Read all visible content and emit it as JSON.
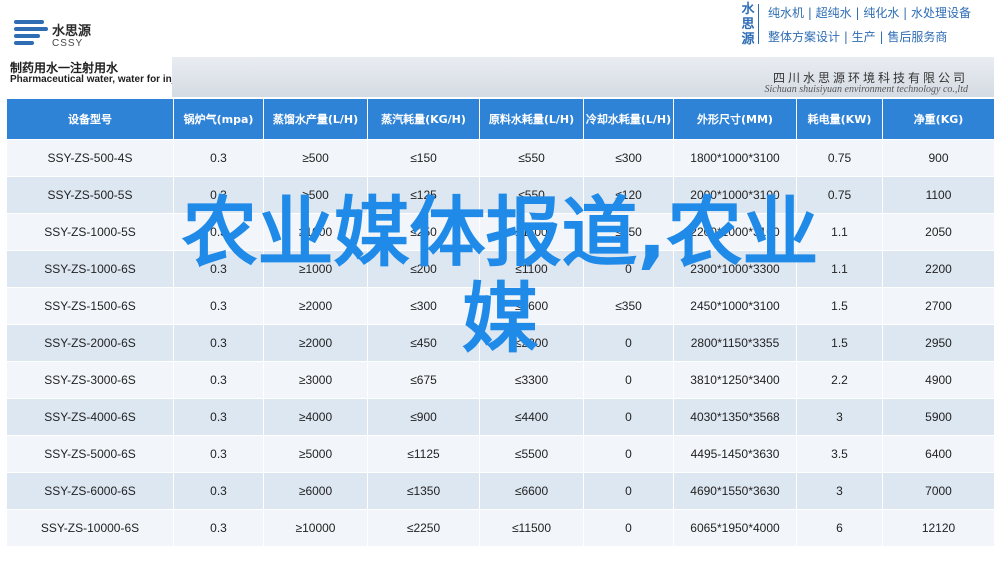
{
  "header": {
    "logo_cn": "水思源",
    "logo_en": "CSSY",
    "brand_vertical": "水思源",
    "brand_line1": "纯水机 | 超纯水 | 纯化水 | 水处理设备",
    "brand_line2": "整体方案设计 | 生产 | 售后服务商",
    "title_cn": "制药用水一注射用水",
    "title_en": "Pharmaceutical water, water for injection",
    "company_cn": "四川水思源环境科技有限公司",
    "company_en": "Sichuan shuisiyuan environment technology co.,ltd"
  },
  "table": {
    "headers": [
      "设备型号",
      "锅炉气(mpa)",
      "蒸馏水产量(L/H)",
      "蒸汽耗量(KG/H)",
      "原料水耗量(L/H)",
      "冷却水耗量(L/H)",
      "外形尺寸(MM)",
      "耗电量(KW)",
      "净重(KG)"
    ],
    "rows": [
      [
        "SSY-ZS-500-4S",
        "0.3",
        "≥500",
        "≤150",
        "≤550",
        "≤300",
        "1800*1000*3100",
        "0.75",
        "900"
      ],
      [
        "SSY-ZS-500-5S",
        "0.3",
        "≥500",
        "≤125",
        "≤550",
        "≤120",
        "2000*1000*3100",
        "0.75",
        "1100"
      ],
      [
        "SSY-ZS-1000-5S",
        "0.3",
        "≥1000",
        "≤250",
        "≤1100",
        "≤250",
        "2200*1000*3100",
        "1.1",
        "2050"
      ],
      [
        "SSY-ZS-1000-6S",
        "0.3",
        "≥1000",
        "≤200",
        "≤1100",
        "0",
        "2300*1000*3300",
        "1.1",
        "2200"
      ],
      [
        "SSY-ZS-1500-6S",
        "0.3",
        "≥2000",
        "≤300",
        "≤1600",
        "≤350",
        "2450*1000*3100",
        "1.5",
        "2700"
      ],
      [
        "SSY-ZS-2000-6S",
        "0.3",
        "≥2000",
        "≤450",
        "≤2200",
        "0",
        "2800*1150*3355",
        "1.5",
        "2950"
      ],
      [
        "SSY-ZS-3000-6S",
        "0.3",
        "≥3000",
        "≤675",
        "≤3300",
        "0",
        "3810*1250*3400",
        "2.2",
        "4900"
      ],
      [
        "SSY-ZS-4000-6S",
        "0.3",
        "≥4000",
        "≤900",
        "≤4400",
        "0",
        "4030*1350*3568",
        "3",
        "5900"
      ],
      [
        "SSY-ZS-5000-6S",
        "0.3",
        "≥5000",
        "≤1125",
        "≤5500",
        "0",
        "4495-1450*3630",
        "3.5",
        "6400"
      ],
      [
        "SSY-ZS-6000-6S",
        "0.3",
        "≥6000",
        "≤1350",
        "≤6600",
        "0",
        "4690*1550*3630",
        "3",
        "7000"
      ],
      [
        "SSY-ZS-10000-6S",
        "0.3",
        "≥10000",
        "≤2250",
        "≤11500",
        "0",
        "6065*1950*4000",
        "6",
        "12120"
      ]
    ]
  },
  "overlay": {
    "line1": "农业媒体报道,农业",
    "line2": "媒"
  }
}
